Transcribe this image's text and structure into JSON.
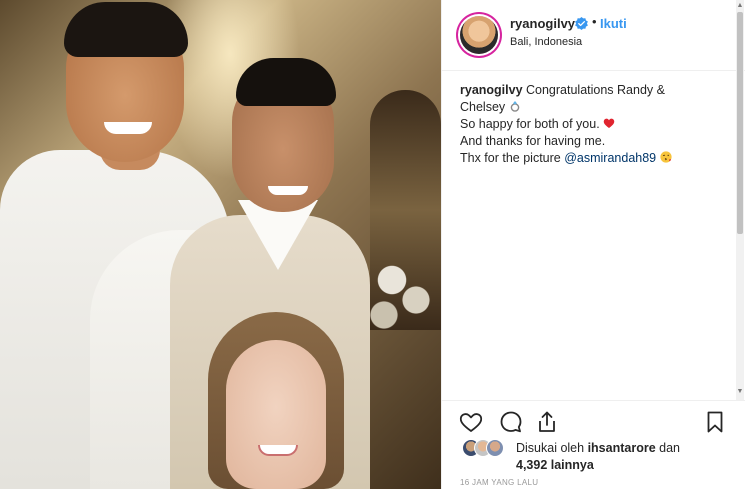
{
  "post": {
    "photo_alt": "photo"
  },
  "header": {
    "username": "ryanogilvy",
    "dot": "•",
    "follow_label": "Ikuti",
    "location": "Bali, Indonesia"
  },
  "caption": {
    "username": "ryanogilvy",
    "line1": " Congratulations Randy &",
    "line2": "Chelsey ",
    "line3": "So happy for both of you. ",
    "line4": "And thanks for having me.",
    "line5_prefix": "Thx for the picture ",
    "mention": "@asmirandah89",
    "line5_suffix": " "
  },
  "icons": {
    "like": "heart-icon",
    "comment": "comment-icon",
    "share": "share-icon",
    "save": "bookmark-icon",
    "verified": "verified-badge-icon",
    "ring": "ring-emoji",
    "heart_emoji": "red-heart-emoji",
    "kiss_emoji": "kiss-face-emoji"
  },
  "likes": {
    "prefix": "Disukai oleh ",
    "liker": "ihsantarore",
    "middle": " dan",
    "count": "4,392 lainnya"
  },
  "timestamp": "16 JAM YANG LALU",
  "colors": {
    "link_blue": "#3897f0",
    "mention_blue": "#003569",
    "text": "#262626",
    "muted": "#999999",
    "heart_red": "#ed4956"
  }
}
